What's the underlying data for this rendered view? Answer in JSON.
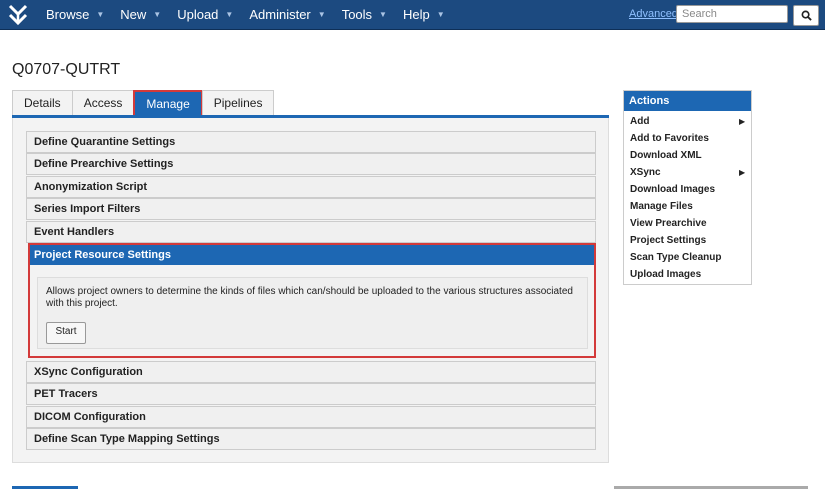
{
  "nav": {
    "items": [
      {
        "label": "Browse",
        "has_menu": true
      },
      {
        "label": "New",
        "has_menu": true
      },
      {
        "label": "Upload",
        "has_menu": true
      },
      {
        "label": "Administer",
        "has_menu": true
      },
      {
        "label": "Tools",
        "has_menu": true
      },
      {
        "label": "Help",
        "has_menu": true
      }
    ],
    "advanced_label": "Advanced",
    "search_placeholder": "Search",
    "search_icon": "search-icon"
  },
  "page": {
    "title": "Q0707-QUTRT"
  },
  "tabs": [
    {
      "label": "Details",
      "active": false
    },
    {
      "label": "Access",
      "active": false
    },
    {
      "label": "Manage",
      "active": true
    },
    {
      "label": "Pipelines",
      "active": false
    }
  ],
  "manage": {
    "sections_before": [
      {
        "label": "Define Quarantine Settings"
      },
      {
        "label": "Define Prearchive Settings"
      },
      {
        "label": "Anonymization Script"
      },
      {
        "label": "Series Import Filters"
      },
      {
        "label": "Event Handlers"
      }
    ],
    "active_section": {
      "label": "Project Resource Settings",
      "description": "Allows project owners to determine the kinds of files which can/should be uploaded to the various structures associated with this project.",
      "button_label": "Start"
    },
    "sections_after": [
      {
        "label": "XSync Configuration"
      },
      {
        "label": "PET Tracers"
      },
      {
        "label": "DICOM Configuration"
      },
      {
        "label": "Define Scan Type Mapping Settings"
      }
    ]
  },
  "actions": {
    "title": "Actions",
    "items": [
      {
        "label": "Add",
        "submenu": true
      },
      {
        "label": "Add to Favorites",
        "submenu": false
      },
      {
        "label": "Download XML",
        "submenu": false
      },
      {
        "label": "XSync",
        "submenu": true
      },
      {
        "label": "Download Images",
        "submenu": false
      },
      {
        "label": "Manage Files",
        "submenu": false
      },
      {
        "label": "View Prearchive",
        "submenu": false
      },
      {
        "label": "Project Settings",
        "submenu": false
      },
      {
        "label": "Scan Type Cleanup",
        "submenu": false
      },
      {
        "label": "Upload Images",
        "submenu": false
      }
    ]
  },
  "colors": {
    "topbar": "#1c4a80",
    "accent": "#1d67b3",
    "highlight_border": "#d33a3a"
  }
}
